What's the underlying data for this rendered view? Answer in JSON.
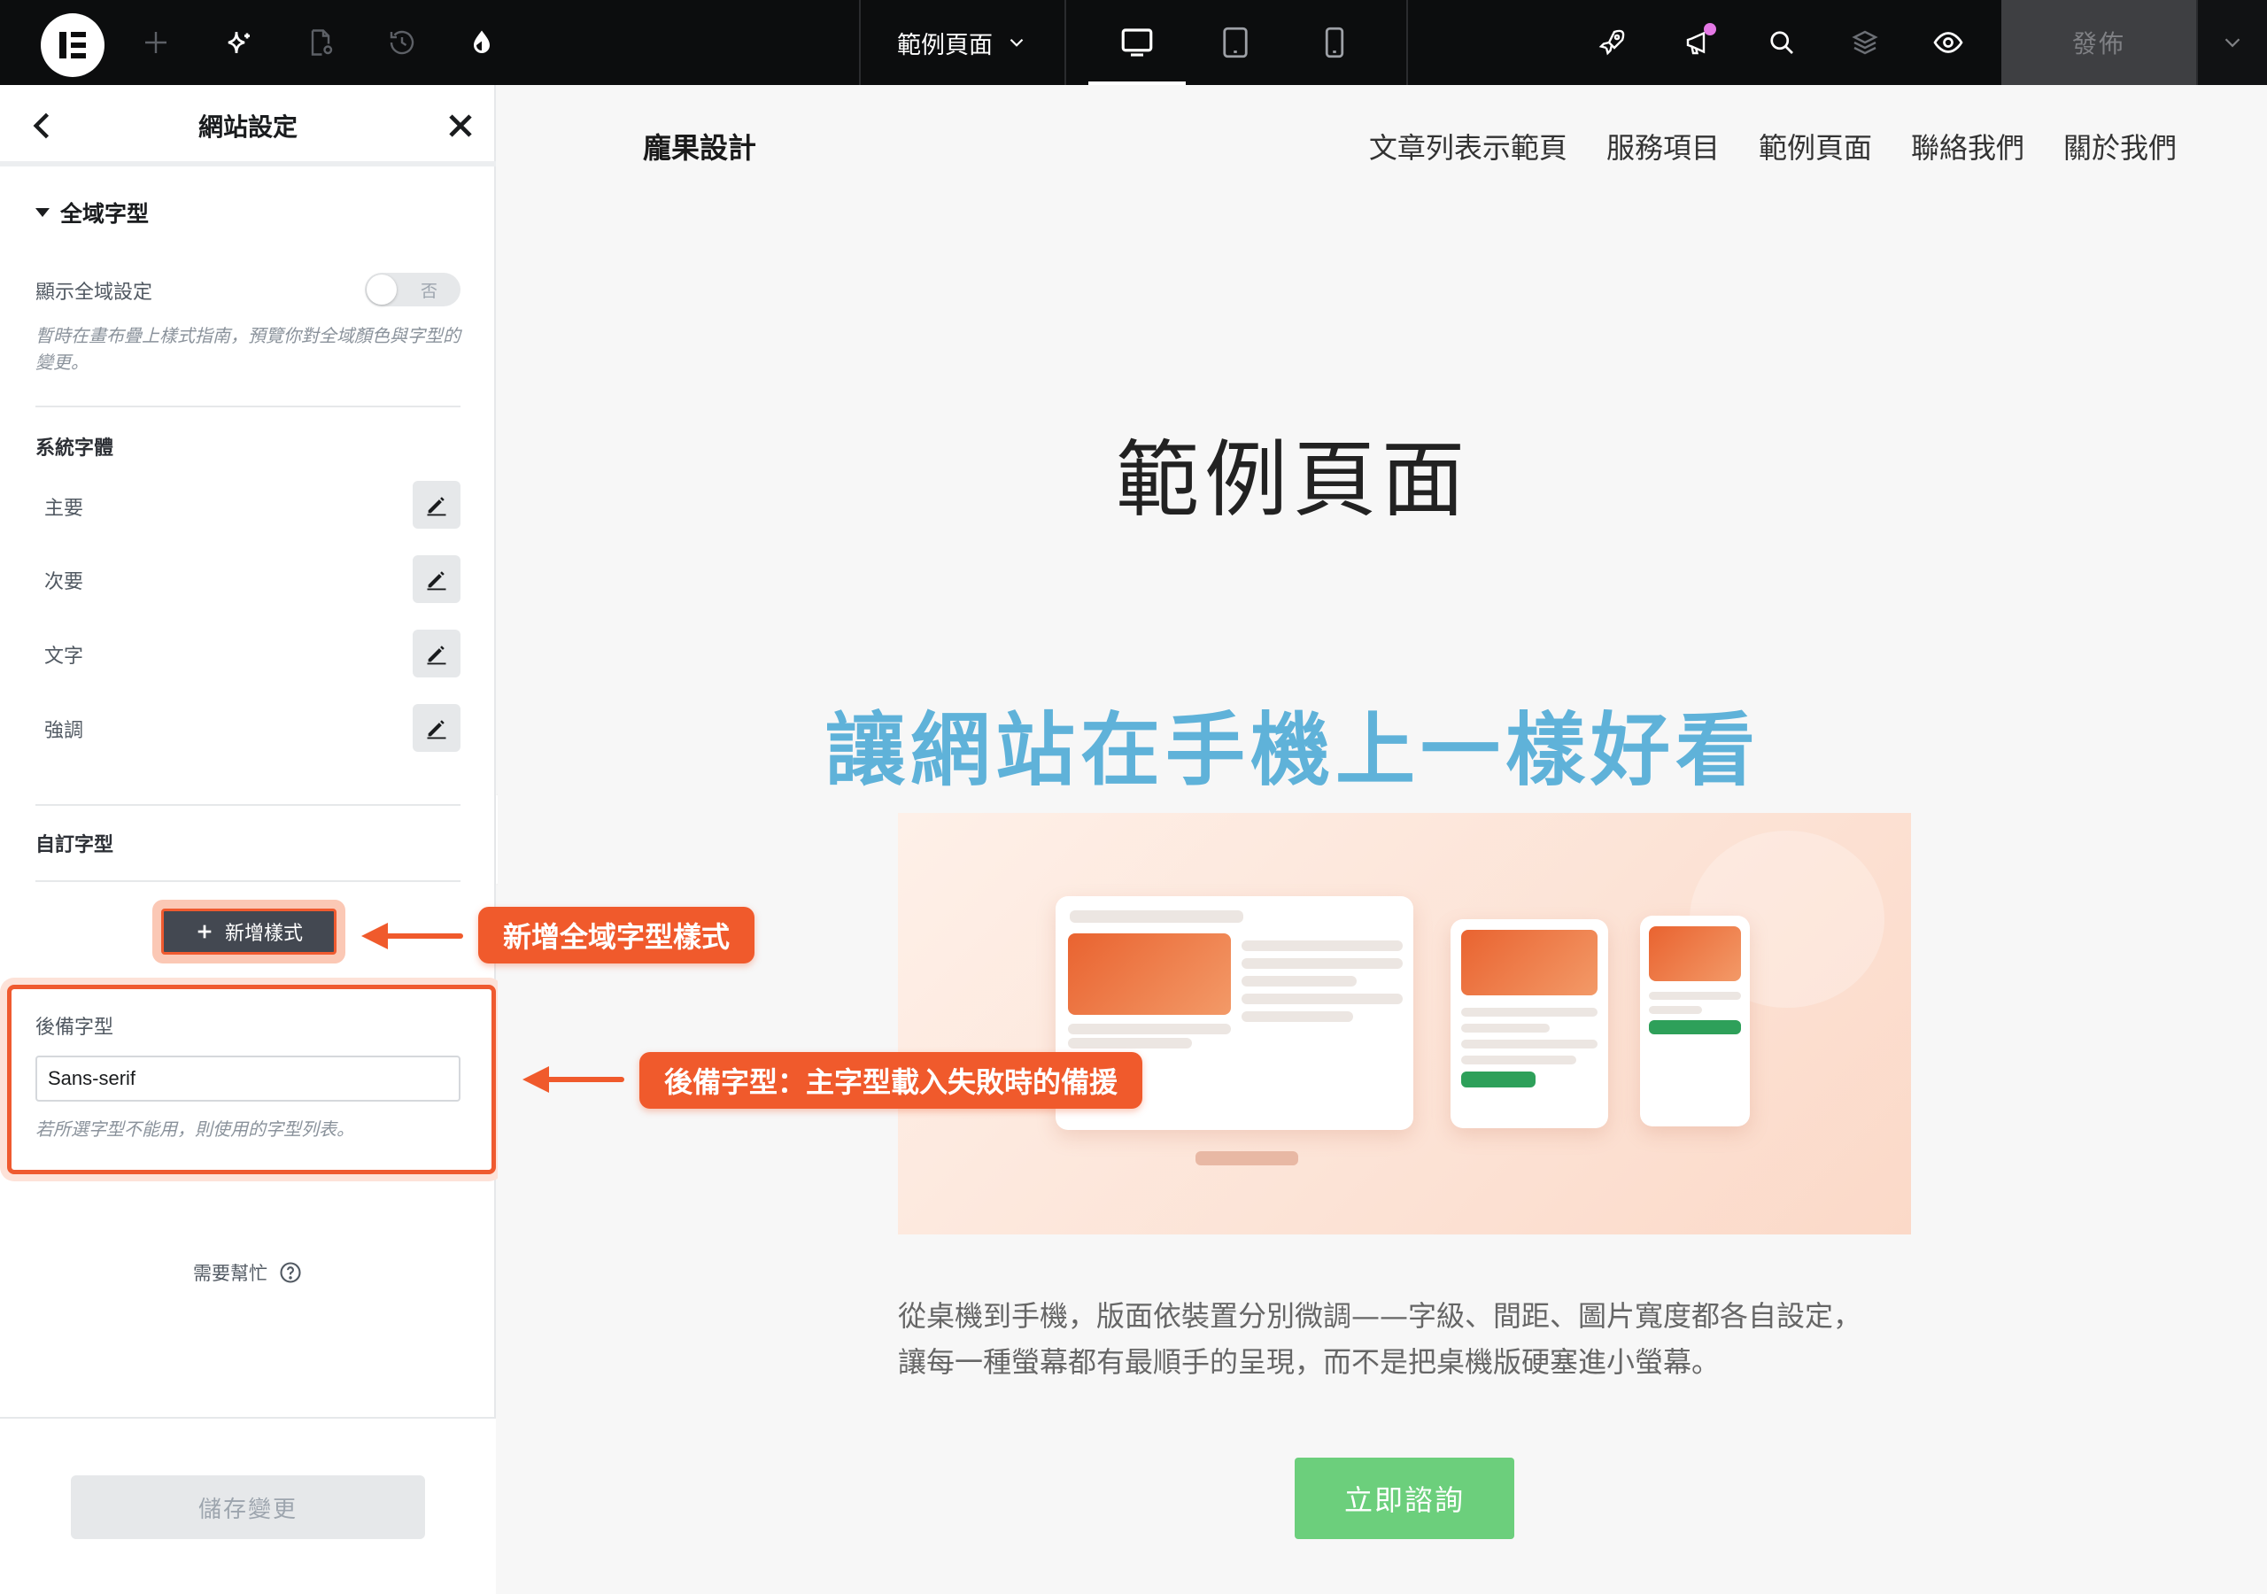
{
  "topbar": {
    "page_selector": "範例頁面",
    "publish_label": "發佈",
    "icons": [
      "elementor-logo-icon",
      "add-icon",
      "ai-sparkle-icon",
      "page-settings-icon",
      "history-icon",
      "theme-style-icon",
      "desktop-icon",
      "tablet-icon",
      "mobile-icon",
      "rocket-icon",
      "announcement-icon",
      "search-icon",
      "structure-layers-icon",
      "preview-eye-icon",
      "chevron-down-icon"
    ],
    "notif_color": "#e478e5"
  },
  "panel": {
    "title": "網站設定",
    "section_title": "全域字型",
    "show_global": {
      "label": "顯示全域設定",
      "toggle_text": "否",
      "help": "暫時在畫布疊上樣式指南，預覽你對全域顏色與字型的變更。"
    },
    "system_fonts": {
      "title": "系統字體",
      "items": [
        {
          "label": "主要"
        },
        {
          "label": "次要"
        },
        {
          "label": "文字"
        },
        {
          "label": "強調"
        }
      ]
    },
    "custom_fonts": {
      "title": "自訂字型",
      "add_button": "新增樣式"
    },
    "fallback": {
      "label": "後備字型",
      "value": "Sans-serif",
      "help": "若所選字型不能用，則使用的字型列表。"
    },
    "need_help": "需要幫忙",
    "save_button": "儲存變更"
  },
  "annotations": {
    "add_global_style": "新增全域字型樣式",
    "fallback_note": "後備字型：主字型載入失敗時的備援",
    "color": "#f05a2c"
  },
  "preview": {
    "site_logo": "龐果設計",
    "nav": [
      "文章列表示範頁",
      "服務項目",
      "範例頁面",
      "聯絡我們",
      "關於我們"
    ],
    "page_title": "範例頁面",
    "headline": "讓網站在手機上一樣好看",
    "headline_color": "#5fb2d9",
    "body_lines": [
      "從桌機到手機，版面依裝置分別微調——字級、間距、圖片寬度都各自設定，",
      "讓每一種螢幕都有最順手的呈現，而不是把桌機版硬塞進小螢幕。"
    ],
    "cta": "立即諮詢",
    "cta_color": "#6ccf7c"
  }
}
